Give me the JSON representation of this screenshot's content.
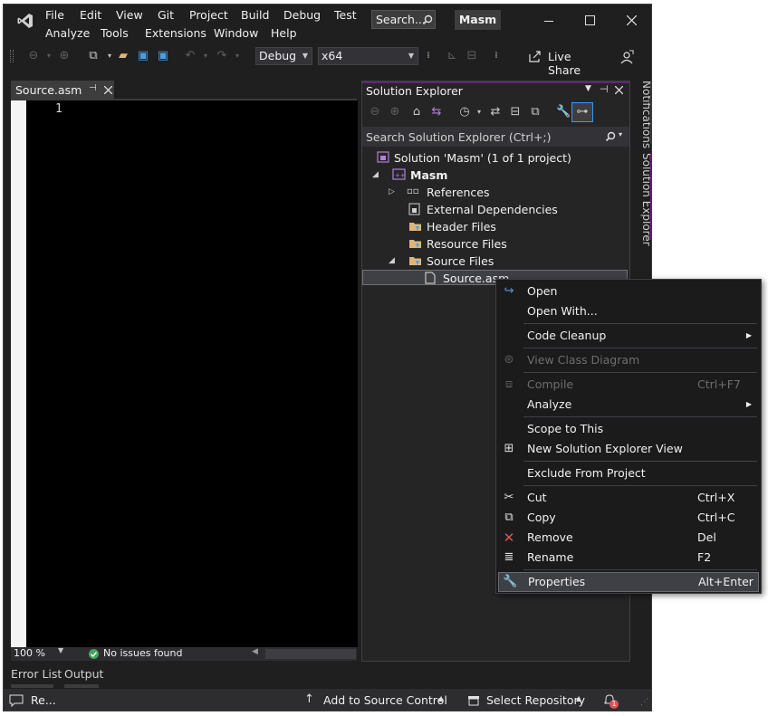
{
  "titlebar": {
    "menu_row1": [
      "File",
      "Edit",
      "View",
      "Git",
      "Project",
      "Build",
      "Debug",
      "Test"
    ],
    "menu_row2": [
      "Analyze",
      "Tools",
      "Extensions",
      "Window",
      "Help"
    ],
    "search_label": "Search...",
    "solution_name": "Masm"
  },
  "toolbar": {
    "config": "Debug",
    "platform": "x64",
    "live_share": "Live Share"
  },
  "editor": {
    "tab_label": "Source.asm",
    "line_numbers": [
      "1"
    ],
    "zoom": "100 %",
    "status": "No issues found"
  },
  "bottom_tabs": [
    "Error List",
    "Output"
  ],
  "side_tabs": [
    "Notifications",
    "Solution Explorer"
  ],
  "solution_explorer": {
    "title": "Solution Explorer",
    "search_placeholder": "Search Solution Explorer (Ctrl+;)",
    "tree": [
      {
        "label": "Solution 'Masm'   (1 of 1 project)",
        "icon": "solution-icon"
      },
      {
        "label": "Masm",
        "icon": "project-icon"
      },
      {
        "label": "References",
        "icon": "references-icon"
      },
      {
        "label": "External Dependencies",
        "icon": "external-deps-icon"
      },
      {
        "label": "Header Files",
        "icon": "folder-icon"
      },
      {
        "label": "Resource Files",
        "icon": "folder-icon"
      },
      {
        "label": "Source Files",
        "icon": "folder-icon"
      },
      {
        "label": "Source.asm",
        "icon": "file-icon"
      }
    ]
  },
  "context_menu": {
    "items": [
      {
        "label": "Open",
        "shortcut": "",
        "icon": "open-arrow-icon",
        "disabled": false,
        "submenu": false
      },
      {
        "label": "Open With...",
        "shortcut": "",
        "icon": "",
        "disabled": false,
        "submenu": false
      },
      {
        "label": "Code Cleanup",
        "shortcut": "",
        "icon": "",
        "disabled": false,
        "submenu": true
      },
      {
        "label": "View Class Diagram",
        "shortcut": "",
        "icon": "class-diagram-icon",
        "disabled": true,
        "submenu": false
      },
      {
        "label": "Compile",
        "shortcut": "Ctrl+F7",
        "icon": "compile-icon",
        "disabled": true,
        "submenu": false
      },
      {
        "label": "Analyze",
        "shortcut": "",
        "icon": "",
        "disabled": false,
        "submenu": true
      },
      {
        "label": "Scope to This",
        "shortcut": "",
        "icon": "",
        "disabled": false,
        "submenu": false
      },
      {
        "label": "New Solution Explorer View",
        "shortcut": "",
        "icon": "new-view-icon",
        "disabled": false,
        "submenu": false
      },
      {
        "label": "Exclude From Project",
        "shortcut": "",
        "icon": "",
        "disabled": false,
        "submenu": false
      },
      {
        "label": "Cut",
        "shortcut": "Ctrl+X",
        "icon": "scissors-icon",
        "disabled": false,
        "submenu": false
      },
      {
        "label": "Copy",
        "shortcut": "Ctrl+C",
        "icon": "copy-icon",
        "disabled": false,
        "submenu": false
      },
      {
        "label": "Remove",
        "shortcut": "Del",
        "icon": "remove-x-icon",
        "disabled": false,
        "submenu": false
      },
      {
        "label": "Rename",
        "shortcut": "F2",
        "icon": "rename-icon",
        "disabled": false,
        "submenu": false
      },
      {
        "label": "Properties",
        "shortcut": "Alt+Enter",
        "icon": "wrench-icon",
        "disabled": false,
        "submenu": false
      }
    ]
  },
  "statusbar": {
    "left": "Re...",
    "source_control": "Add to Source Control",
    "repository": "Select Repository",
    "notification_count": "1"
  },
  "colors": {
    "accent": "#68217a",
    "background": "#1f1f1f",
    "selection": "#3f3f46"
  }
}
